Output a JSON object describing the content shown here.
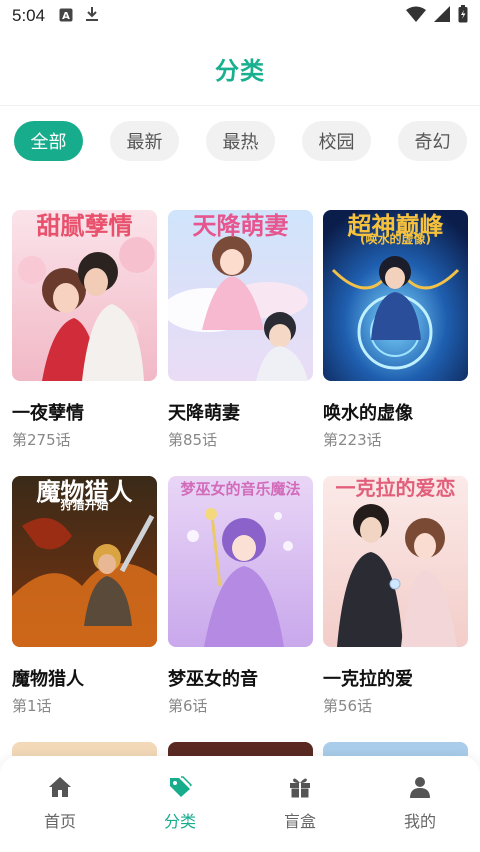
{
  "status_bar": {
    "time": "5:04"
  },
  "header": {
    "title": "分类"
  },
  "tabs": [
    {
      "label": "全部",
      "active": true
    },
    {
      "label": "最新",
      "active": false
    },
    {
      "label": "最热",
      "active": false
    },
    {
      "label": "校园",
      "active": false
    },
    {
      "label": "奇幻",
      "active": false
    }
  ],
  "comics": [
    {
      "cover_title": "甜腻孽情",
      "name": "一夜孽情",
      "episode": "第275话"
    },
    {
      "cover_title": "天降萌妻",
      "name": "天降萌妻",
      "episode": "第85话"
    },
    {
      "cover_title": "超神巅峰",
      "cover_subtitle": "(唤水的虚像)",
      "name": "唤水的虚像",
      "episode": "第223话"
    },
    {
      "cover_title": "魔物猎人",
      "cover_subtitle": "狩猎开始",
      "name": "魔物猎人",
      "episode": "第1话"
    },
    {
      "cover_title": "梦巫女的音乐魔法",
      "name": "梦巫女的音",
      "episode": "第6话"
    },
    {
      "cover_title": "一克拉的爱恋",
      "name": "一克拉的爱",
      "episode": "第56话"
    }
  ],
  "bottom_nav": [
    {
      "label": "首页",
      "icon": "home-icon",
      "active": false
    },
    {
      "label": "分类",
      "icon": "tag-icon",
      "active": true
    },
    {
      "label": "盲盒",
      "icon": "gift-icon",
      "active": false
    },
    {
      "label": "我的",
      "icon": "user-icon",
      "active": false
    }
  ],
  "colors": {
    "accent": "#17ad8c",
    "tab_bg": "#f1f1f1"
  }
}
